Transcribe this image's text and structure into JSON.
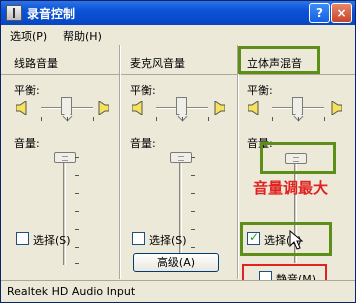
{
  "window": {
    "title": "录音控制"
  },
  "titlebar": {
    "help_label": "?",
    "close_label": "×"
  },
  "menu": {
    "options": "选项(P)",
    "help": "帮助(H)"
  },
  "panels": [
    {
      "title": "线路音量",
      "balance_label": "平衡:",
      "volume_label": "音量:",
      "select_label": "选择(S)",
      "selected": false
    },
    {
      "title": "麦克风音量",
      "balance_label": "平衡:",
      "volume_label": "音量:",
      "select_label": "选择(S)",
      "selected": false,
      "advanced_label": "高级(A)"
    },
    {
      "title": "立体声混音",
      "balance_label": "平衡:",
      "volume_label": "音量:",
      "select_label": "选择(S)",
      "selected": true,
      "mute_label": "静音(M)",
      "muted": false
    }
  ],
  "annotation": {
    "text": "音量调最大",
    "color": "#e22121"
  },
  "highlight_colors": {
    "green": "#5c8f18",
    "red": "#e22121"
  },
  "statusbar": {
    "text": "Realtek HD Audio Input"
  },
  "icons": [
    "app-icon",
    "speaker-left-icon",
    "speaker-right-icon",
    "mouse-cursor-icon"
  ]
}
